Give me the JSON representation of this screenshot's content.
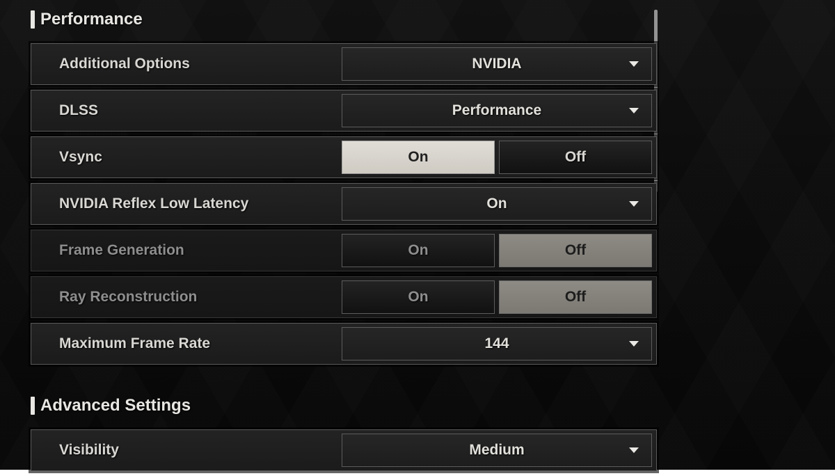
{
  "sections": {
    "performance": {
      "title": "Performance"
    },
    "advanced": {
      "title": "Advanced Settings"
    }
  },
  "labels": {
    "on": "On",
    "off": "Off"
  },
  "rows": {
    "additional_options": {
      "label": "Additional Options",
      "value": "NVIDIA"
    },
    "dlss": {
      "label": "DLSS",
      "value": "Performance"
    },
    "vsync": {
      "label": "Vsync",
      "selected": "On"
    },
    "reflex": {
      "label": "NVIDIA Reflex Low Latency",
      "value": "On"
    },
    "frame_gen": {
      "label": "Frame Generation",
      "selected": "Off"
    },
    "ray_recon": {
      "label": "Ray Reconstruction",
      "selected": "Off"
    },
    "max_frame_rate": {
      "label": "Maximum Frame Rate",
      "value": "144"
    },
    "visibility": {
      "label": "Visibility",
      "value": "Medium"
    }
  }
}
